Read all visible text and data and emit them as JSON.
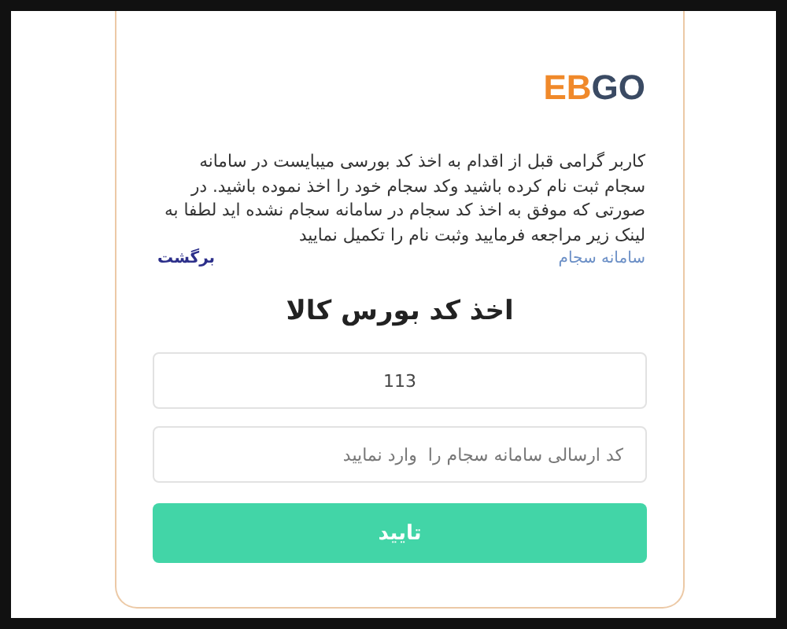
{
  "logo": {
    "orange_part": {
      "text": "EB",
      "color": "#f0892a"
    },
    "dark_part": {
      "text": "GO",
      "color": "#3a4a63"
    }
  },
  "notice": "کاربر گرامی قبل از اقدام به اخذ کد بورسی میبایست در سامانه سجام ثبت نام کرده باشید وکد سجام خود را اخذ نموده باشید. در صورتی که موفق به اخذ کد سجام در سامانه سجام نشده اید لطفا به لینک زیر مراجعه فرمایید وثبت نام را تکمیل نمایید",
  "links": [
    {
      "kind": "sejam",
      "label": "سامانه سجام"
    },
    {
      "kind": "back",
      "label": "برگشت"
    }
  ],
  "title": "اخذ کد بورس کالا",
  "fields": [
    {
      "value": "113"
    },
    {
      "placeholder": "کد ارسالی سامانه سجام را  وارد نمایید"
    }
  ],
  "submit": "تایید"
}
